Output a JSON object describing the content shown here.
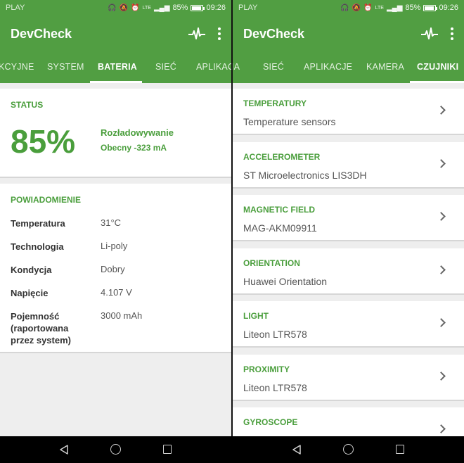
{
  "status_bar": {
    "carrier": "PLAY",
    "lte_label": "LTE",
    "battery_text": "85%",
    "battery_level": 0.85,
    "time": "09:26"
  },
  "app": {
    "title": "DevCheck"
  },
  "left": {
    "tabs": [
      "KCYJNE",
      "SYSTEM",
      "BATERIA",
      "SIEĆ",
      "APLIKACJA"
    ],
    "active_tab": "BATERIA",
    "status_card": {
      "title": "STATUS",
      "percent": "85%",
      "state": "Rozładowywanie",
      "current": "Obecny -323 mA"
    },
    "notification_card": {
      "title": "POWIADOMIENIE",
      "rows": [
        {
          "label": "Temperatura",
          "value": "31°C"
        },
        {
          "label": "Technologia",
          "value": "Li-poly"
        },
        {
          "label": "Kondycja",
          "value": "Dobry"
        },
        {
          "label": "Napięcie",
          "value": "4.107 V"
        },
        {
          "label": "Pojemność\n(raportowana\nprzez system)",
          "value": "3000 mAh"
        }
      ]
    }
  },
  "right": {
    "tabs": [
      "IA",
      "SIEĆ",
      "APLIKACJE",
      "KAMERA",
      "CZUJNIKI"
    ],
    "active_tab": "CZUJNIKI",
    "sensors": [
      {
        "name": "TEMPERATURY",
        "vendor": "Temperature sensors"
      },
      {
        "name": "ACCELEROMETER",
        "vendor": "ST Microelectronics LIS3DH"
      },
      {
        "name": "MAGNETIC FIELD",
        "vendor": "MAG-AKM09911"
      },
      {
        "name": "ORIENTATION",
        "vendor": "Huawei Orientation"
      },
      {
        "name": "LIGHT",
        "vendor": "Liteon LTR578"
      },
      {
        "name": "PROXIMITY",
        "vendor": "Liteon LTR578"
      },
      {
        "name": "GYROSCOPE",
        "vendor": ""
      }
    ]
  },
  "colors": {
    "primary": "#519e42",
    "accent_text": "#4a9e3c",
    "background": "#eeeeee"
  },
  "icons": [
    "headphones-icon",
    "mute-icon",
    "alarm-icon",
    "signal-icon",
    "battery-icon",
    "pulse-icon",
    "more-vert-icon",
    "chevron-right-icon",
    "nav-back-icon",
    "nav-home-icon",
    "nav-recents-icon"
  ]
}
